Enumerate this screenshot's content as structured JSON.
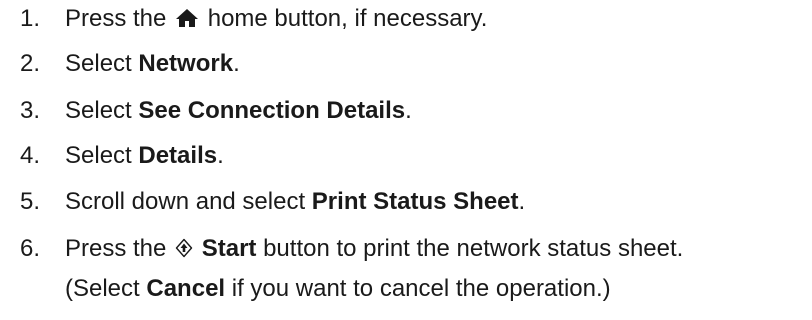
{
  "steps": [
    {
      "number": "1.",
      "before": "Press the ",
      "icon": "home-icon",
      "after": " home button, if necessary."
    },
    {
      "number": "2.",
      "before": "Select ",
      "bold": "Network",
      "after": "."
    },
    {
      "number": "3.",
      "before": "Select ",
      "bold": "See Connection Details",
      "after": "."
    },
    {
      "number": "4.",
      "before": "Select ",
      "bold": "Details",
      "after": "."
    },
    {
      "number": "5.",
      "before": "Scroll down and select ",
      "bold": "Print Status Sheet",
      "after": "."
    },
    {
      "number": "6.",
      "before": "Press the ",
      "icon": "start-icon",
      "bold": "Start",
      "after": " button to print the network status sheet.",
      "continuation": {
        "before": "(Select ",
        "bold": "Cancel",
        "after": " if you want to cancel the operation.)"
      }
    }
  ]
}
